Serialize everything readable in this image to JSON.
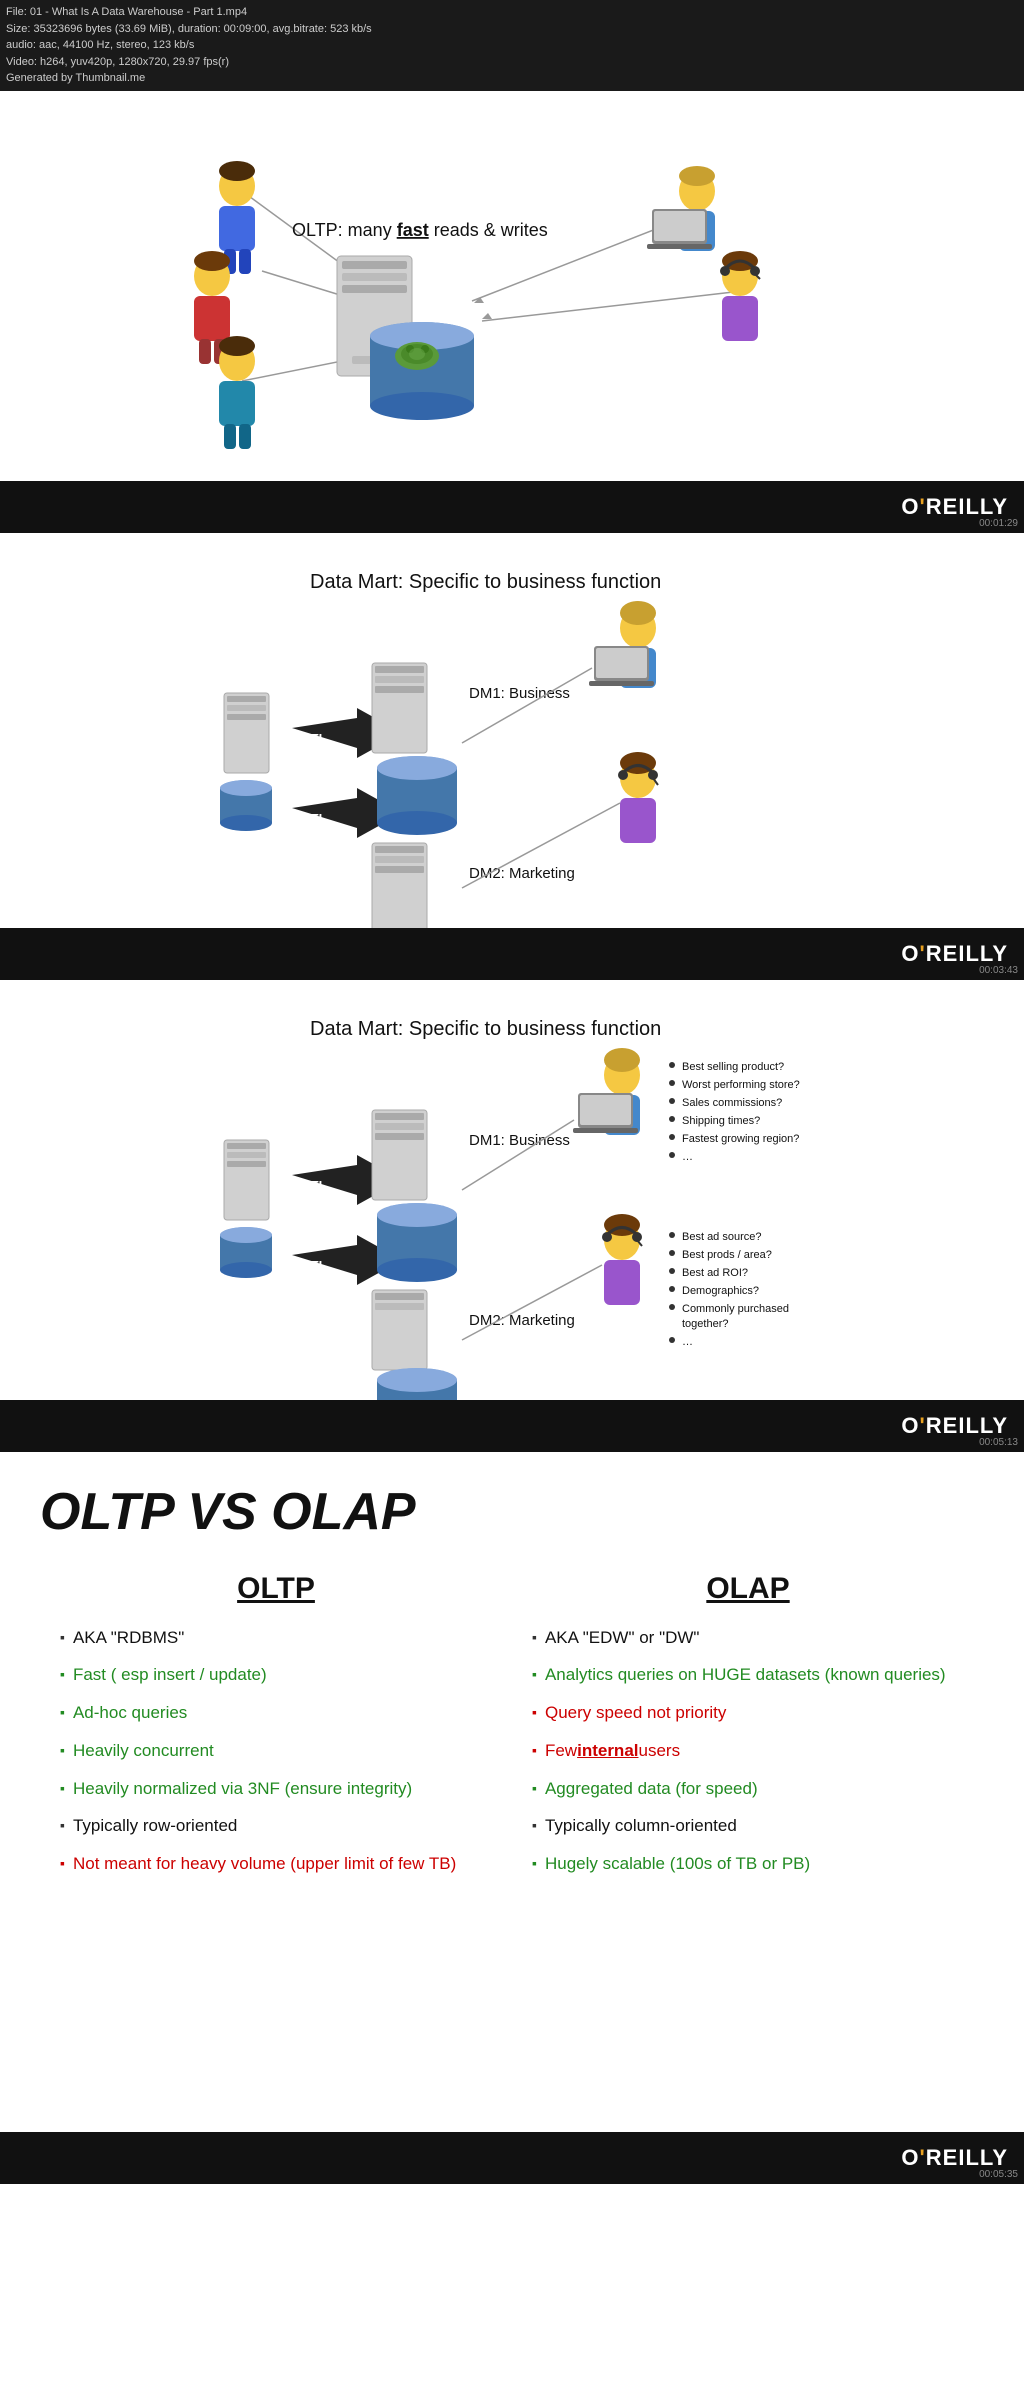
{
  "file_info": {
    "line1": "File: 01 - What Is A Data Warehouse - Part 1.mp4",
    "line2": "Size: 35323696 bytes (33.69 MiB), duration: 00:09:00, avg.bitrate: 523 kb/s",
    "line3": "  audio: aac, 44100 Hz, stereo, 123 kb/s",
    "line4": "  Video: h264, yuv420p, 1280x720, 29.97 fps(r)",
    "line5": "  Generated by Thumbnail.me"
  },
  "slides": [
    {
      "id": "slide1",
      "timestamp": "00:01:29",
      "oltp_label": "OLTP: many fast reads & writes"
    },
    {
      "id": "slide2",
      "timestamp": "00:03:43",
      "title": "Data Mart: Specific to business function",
      "dm1_label": "DM1: Business",
      "dm2_label": "DM2: Marketing",
      "etl1": "ETL",
      "etl2": "ETL"
    },
    {
      "id": "slide3",
      "timestamp": "00:05:13",
      "title": "Data Mart: Specific to business function",
      "dm1_label": "DM1: Business",
      "dm2_label": "DM2: Marketing",
      "etl1": "ETL",
      "etl2": "ETL",
      "business_bullets": [
        "Best selling product?",
        "Worst performing store?",
        "Sales commissions?",
        "Shipping times?",
        "Fastest growing region?",
        "…"
      ],
      "marketing_bullets": [
        "Best ad source?",
        "Best prods / area?",
        "Best ad ROI?",
        "Demographics?",
        "Commonly purchased together?",
        "…"
      ]
    },
    {
      "id": "slide4",
      "timestamp": "00:05:35",
      "main_title": "OLTP VS OLAP",
      "oltp": {
        "header": "OLTP",
        "bullets": [
          {
            "text": "AKA \"RDBMS\"",
            "color": "black"
          },
          {
            "text": "Fast ( esp insert / update)",
            "color": "green"
          },
          {
            "text": "Ad-hoc queries",
            "color": "green"
          },
          {
            "text": "Heavily concurrent",
            "color": "green"
          },
          {
            "text": "Heavily normalized via 3NF (ensure integrity)",
            "color": "green"
          },
          {
            "text": "Typically row-oriented",
            "color": "black"
          },
          {
            "text": "Not meant for heavy volume (upper limit of few TB)",
            "color": "red"
          }
        ]
      },
      "olap": {
        "header": "OLAP",
        "bullets": [
          {
            "text": "AKA \"EDW\" or \"DW\"",
            "color": "black"
          },
          {
            "text": "Analytics queries on HUGE datasets (known queries)",
            "color": "col-green"
          },
          {
            "text": "Query speed not priority",
            "color": "col-red"
          },
          {
            "text": "Few internal users",
            "color": "col-red",
            "underline_word": "internal"
          },
          {
            "text": "Aggregated data (for speed)",
            "color": "col-green"
          },
          {
            "text": "Typically column-oriented",
            "color": "black"
          },
          {
            "text": "Hugely scalable (100s of TB or PB)",
            "color": "col-green"
          }
        ]
      }
    }
  ],
  "oreilly": {
    "text": "O'REILLY"
  }
}
